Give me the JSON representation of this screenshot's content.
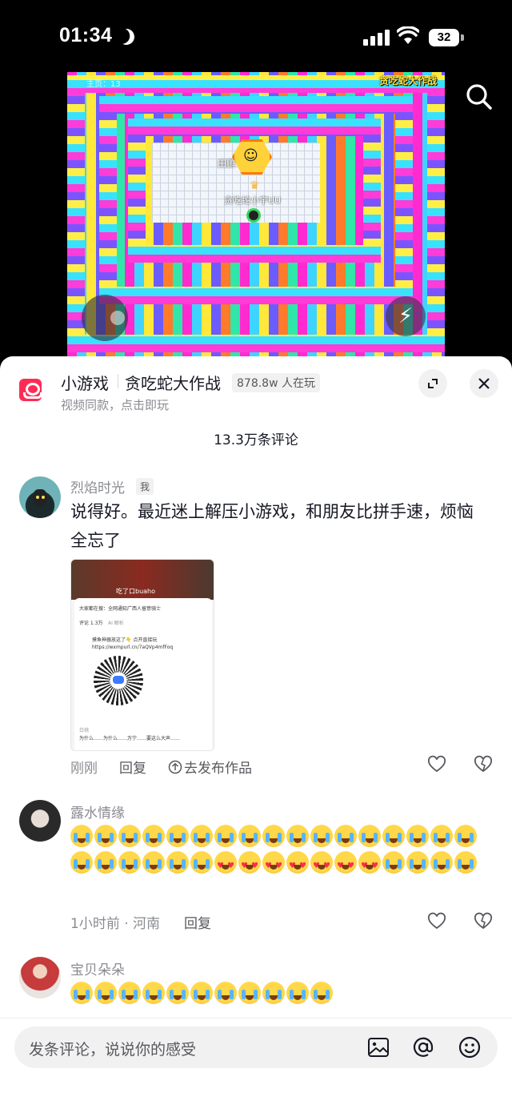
{
  "status_bar": {
    "time": "01:34",
    "battery": "32"
  },
  "video": {
    "game_title_overlay": "贪吃蛇大作战",
    "score_text": "主页：13",
    "player_label_1": "田鹏",
    "player_label_2": "贪吃蛇小宇UU"
  },
  "game_card": {
    "tag": "小游戏",
    "name": "贪吃蛇大作战",
    "players": "878.8w 人在玩",
    "subtitle": "视频同款，点击即玩"
  },
  "comments_header": {
    "count": "13.3万条评论"
  },
  "comments": [
    {
      "name": "烈焰时光",
      "badge": "我",
      "text": "说得好。最近迷上解压小游戏，和朋友比拼手速，烦恼全忘了",
      "attachment": {
        "video_caption": "吃了口buaho",
        "sheet_header": "大家都在搜：全网通知广西人留意骑士",
        "sheet_tab_comments": "评论 1.3万",
        "sheet_tab_ai": "AI 解析",
        "sheet_comment_text": "摸鱼神器放这了👇 点开直接玩 https://wxmpurl.cn/7aQVp4mfFoq",
        "sheet_reply_name": "白桃",
        "sheet_reply_text": "为什么……为什么……万宁……要这么大声……"
      },
      "meta": "刚刚",
      "reply": "回复",
      "publish": "去发布作品"
    },
    {
      "name": "露水情缘",
      "emojis": [
        "cry",
        "cry",
        "cry",
        "cry",
        "cry",
        "cry",
        "cry",
        "cry",
        "cry",
        "cry",
        "cry",
        "cry",
        "cry",
        "cry",
        "cry",
        "cry",
        "cry",
        "cry",
        "cry",
        "cry",
        "cry",
        "cry",
        "cry",
        "love",
        "love",
        "love",
        "love",
        "love",
        "love",
        "love",
        "cry",
        "cry",
        "cry",
        "cry"
      ],
      "meta": "1小时前 · 河南",
      "reply": "回复"
    },
    {
      "name": "宝贝朵朵",
      "emojis": [
        "cry",
        "cry",
        "cry",
        "cry",
        "cry",
        "cry",
        "cry",
        "cry",
        "cry",
        "cry",
        "cry"
      ]
    }
  ],
  "input": {
    "placeholder": "发条评论，说说你的感受"
  }
}
